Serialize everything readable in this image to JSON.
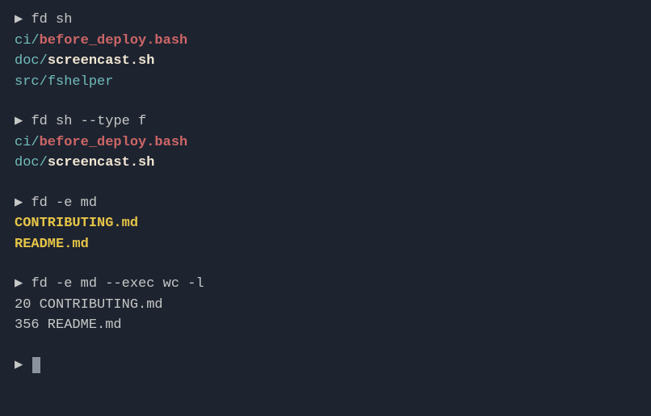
{
  "prompt": "▶",
  "blocks": {
    "b1": {
      "command": "fd sh",
      "r1_dir": "ci/",
      "r1_file": "before_deploy.bash",
      "r2_dir": "doc/",
      "r2_file": "screencast.sh",
      "r3_dir": "src/",
      "r3_file": "fshelper"
    },
    "b2": {
      "command": "fd sh --type f",
      "r1_dir": "ci/",
      "r1_file": "before_deploy.bash",
      "r2_dir": "doc/",
      "r2_file": "screencast.sh"
    },
    "b3": {
      "command": "fd -e md",
      "r1": "CONTRIBUTING.md",
      "r2": "README.md"
    },
    "b4": {
      "command": "fd -e md --exec wc -l",
      "r1": "20 CONTRIBUTING.md",
      "r2": "356 README.md"
    }
  }
}
